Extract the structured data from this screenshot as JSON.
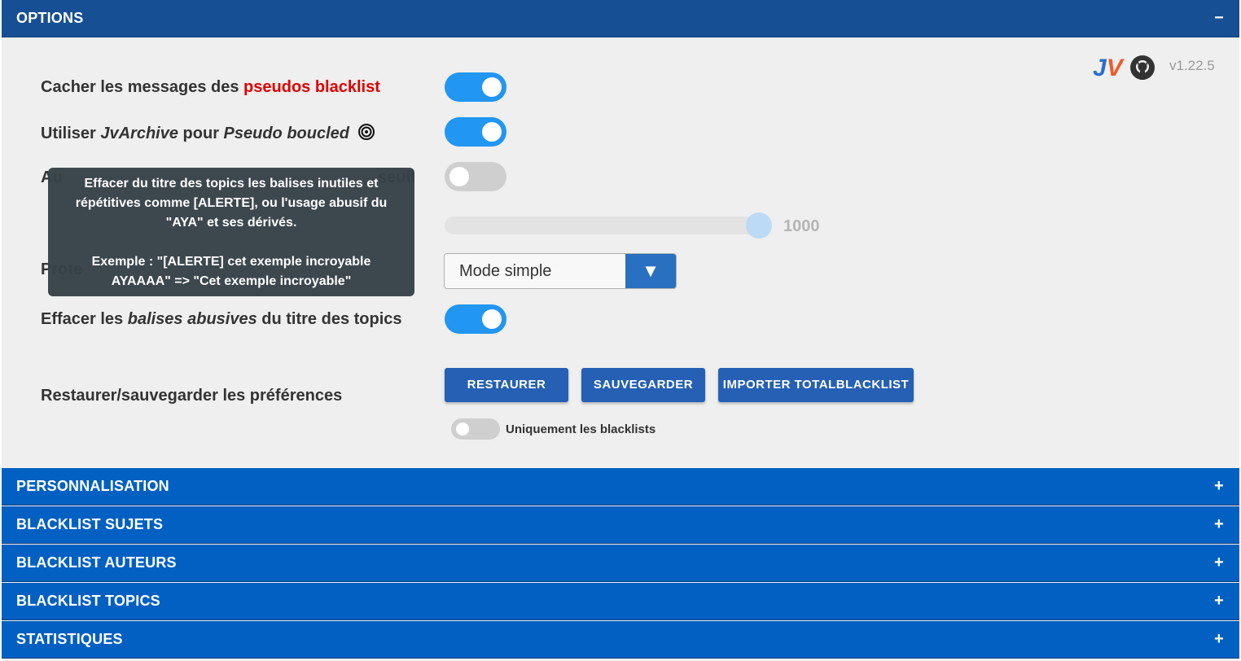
{
  "headers": {
    "options": {
      "title": "OPTIONS",
      "sign": "−"
    },
    "personnalisation": {
      "title": "PERSONNALISATION",
      "sign": "+"
    },
    "blacklist_sujets": {
      "title": "BLACKLIST SUJETS",
      "sign": "+"
    },
    "blacklist_auteurs": {
      "title": "BLACKLIST AUTEURS",
      "sign": "+"
    },
    "blacklist_topics": {
      "title": "BLACKLIST TOPICS",
      "sign": "+"
    },
    "statistiques": {
      "title": "STATISTIQUES",
      "sign": "+"
    }
  },
  "version": "v1.22.5",
  "logo_text": "JV",
  "options": {
    "hide_blacklist": {
      "prefix": "Cacher les messages des ",
      "highlight": "pseudos blacklist",
      "enabled": true
    },
    "jvarchive": {
      "pre": "Utiliser ",
      "i1": "JvArchive",
      "mid": " pour ",
      "i2": "Pseudo boucled",
      "icon": "spiral-icon",
      "enabled": true
    },
    "auto_row": {
      "visible_start": "Au",
      "visible_end": "seuil",
      "enabled": false
    },
    "slider": {
      "value": "1000"
    },
    "protect_row": {
      "visible": "Prote"
    },
    "select": {
      "value": "Mode simple",
      "arrow": "▼"
    },
    "abusive_tags": {
      "pre": "Effacer les ",
      "i": "balises abusives",
      "post": " du titre des topics",
      "enabled": true
    },
    "restore_save": {
      "label": "Restaurer/sauvegarder les préférences"
    }
  },
  "buttons": {
    "restore": "RESTAURER",
    "save": "SAUVEGARDER",
    "import": "IMPORTER TOTALBLACKLIST"
  },
  "only_blacklists": {
    "label": "Uniquement les blacklists",
    "enabled": false
  },
  "tooltip": {
    "line1": "Effacer du titre des topics les balises inutiles et",
    "line2": "répétitives comme [ALERTE], ou l'usage abusif du",
    "line3": "\"AYA\" et ses dérivés.",
    "line4": "Exemple : \"[ALERTE] cet exemple incroyable",
    "line5": "AYAAAA\" => \"Cet exemple incroyable\""
  },
  "colors": {
    "header": "#0260c2",
    "header_active": "#164f93",
    "toggle_on": "#2196f3",
    "highlight": "#e00000",
    "button": "#2560b4"
  }
}
